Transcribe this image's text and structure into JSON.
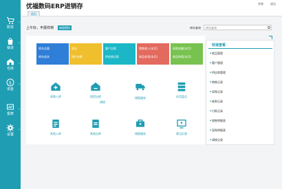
{
  "app": {
    "title": "优福数码ERP进销存",
    "top_links": [
      "系统",
      "退出"
    ],
    "tab_home": "首页"
  },
  "sidebar": {
    "items": [
      {
        "label": "购货",
        "icon": "cart-icon"
      },
      {
        "label": "销货",
        "icon": "bag-icon"
      },
      {
        "label": "仓库",
        "icon": "warehouse-icon"
      },
      {
        "label": "资金",
        "icon": "money-icon"
      },
      {
        "label": "报表",
        "icon": "report-icon"
      },
      {
        "label": "设置",
        "icon": "settings-icon"
      }
    ]
  },
  "header": {
    "greeting": "上午好，丰振祥祺",
    "password_button": "修改密码",
    "search_label": "库存查询",
    "search_placeholder": "库存查询"
  },
  "summary_cards": [
    {
      "line1": "库存总量",
      "line2": "库存成本",
      "color": "#2f7ed8"
    },
    {
      "line1": "现金",
      "line2": "银行存款",
      "color": "#f0bf2d"
    },
    {
      "line1": "客户欠款",
      "line2": "供应商欠款",
      "color": "#1bb7c7"
    },
    {
      "line1": "销售收入(本月)",
      "line2": "商品毛利(本月)",
      "color": "#e36a5e"
    },
    {
      "line1": "采购金额(本月)",
      "line2": "商品种类(本月)",
      "color": "#78c24f"
    }
  ],
  "quick_actions": [
    {
      "label": "采购入库",
      "icon": "purchase-in-icon"
    },
    {
      "label": "销货出库",
      "icon": "sales-out-icon"
    },
    {
      "label": "调拨",
      "icon": "transfer-icon"
    },
    {
      "label": "存货盘点",
      "icon": "inventory-icon"
    },
    {
      "label": "其他入库",
      "icon": "other-in-icon"
    },
    {
      "label": "其他出库",
      "icon": "other-out-icon"
    },
    {
      "label": "增值服务",
      "icon": "value-service-icon"
    },
    {
      "label": "意见反馈",
      "icon": "feedback-icon"
    }
  ],
  "quick_view": {
    "title": "快速查看",
    "items": [
      "商品管理",
      "客户管理",
      "供应商管理",
      "销售记录",
      "采购记录",
      "收款记录",
      "付款记录",
      "销售明细表",
      "采购明细表",
      "调拨记录"
    ]
  }
}
